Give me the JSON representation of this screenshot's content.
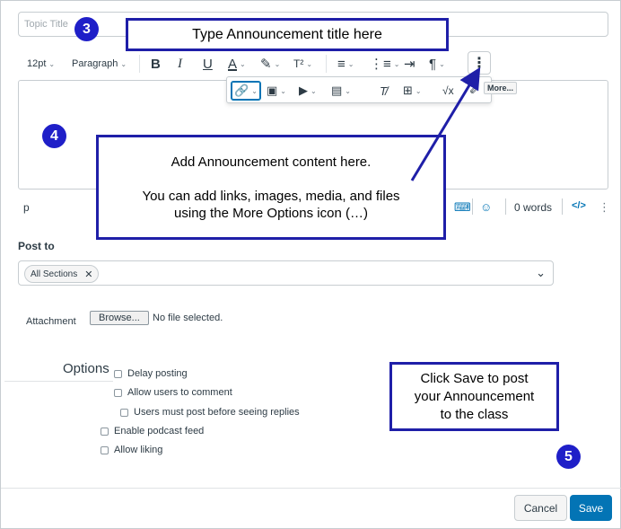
{
  "title_field": {
    "placeholder": "Topic Title"
  },
  "toolbar": {
    "font_size": "12pt",
    "block_format": "Paragraph",
    "bold": "B",
    "italic": "I",
    "underline": "U",
    "text_color": "A",
    "superscript": "T²"
  },
  "popup": {
    "more_tooltip": "More..."
  },
  "status": {
    "element_path": "p",
    "word_count": "0 words",
    "html_toggle": "</>"
  },
  "post_to": {
    "label": "Post to",
    "selected_section": "All Sections"
  },
  "attachment": {
    "label": "Attachment",
    "browse_label": "Browse...",
    "no_file_text": "No file selected."
  },
  "options": {
    "heading": "Options",
    "delay_posting": "Delay posting",
    "allow_comments": "Allow users to comment",
    "must_post": "Users must post before seeing replies",
    "podcast": "Enable podcast feed",
    "liking": "Allow liking"
  },
  "footer": {
    "cancel_label": "Cancel",
    "save_label": "Save"
  },
  "annotations": {
    "badge_title": "3",
    "badge_content": "4",
    "badge_save": "5",
    "title_callout": "Type Announcement title here",
    "content_line1": "Add Announcement content here.",
    "content_line2": "You can add links, images, media, and files",
    "content_line3": "using the More Options icon (…)",
    "save_line1": "Click Save to post",
    "save_line2": "your Announcement",
    "save_line3": "to the class"
  },
  "colors": {
    "primary": "#0374b5",
    "annotation": "#1f1fa8",
    "badge": "#1f1fc8"
  }
}
